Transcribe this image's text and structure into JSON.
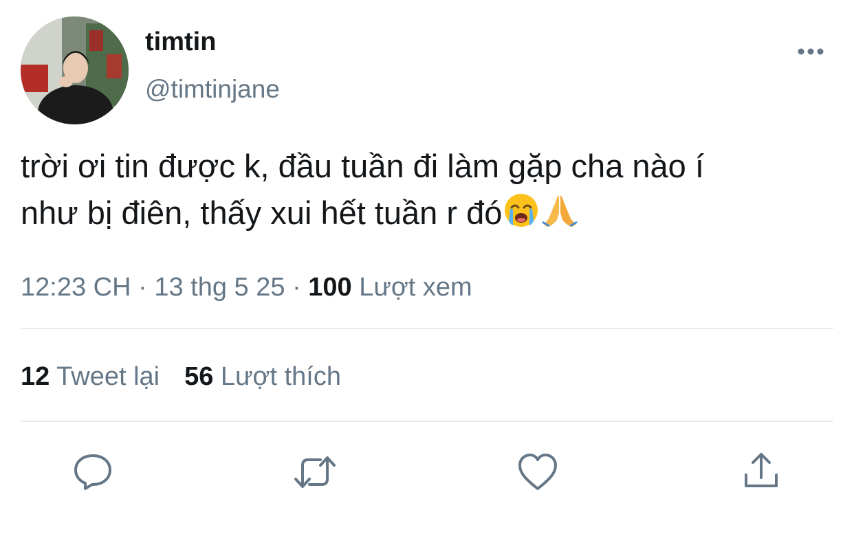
{
  "author": {
    "display_name": "timtin",
    "handle": "@timtinjane",
    "avatar_icon": "profile-photo"
  },
  "tweet": {
    "line1": "trời ơi tin được k, đầu tuần đi làm gặp cha nào í",
    "line2": "như bị điên, thấy xui hết tuần r đó",
    "emojis": [
      "loudly-crying-face",
      "folded-hands"
    ]
  },
  "meta": {
    "time": "12:23 CH",
    "sep1": "·",
    "date": "13 thg 5 25",
    "sep2": "·",
    "views_count": "100",
    "views_label": "Lượt xem"
  },
  "stats": {
    "retweets_count": "12",
    "retweets_label": "Tweet lại",
    "likes_count": "56",
    "likes_label": "Lượt thích"
  },
  "actions": [
    "reply-icon",
    "retweet-icon",
    "like-icon",
    "share-icon"
  ],
  "colors": {
    "text_primary": "#14171a",
    "text_secondary": "#657786",
    "divider": "#e6ecf0",
    "icon": "#657786"
  }
}
